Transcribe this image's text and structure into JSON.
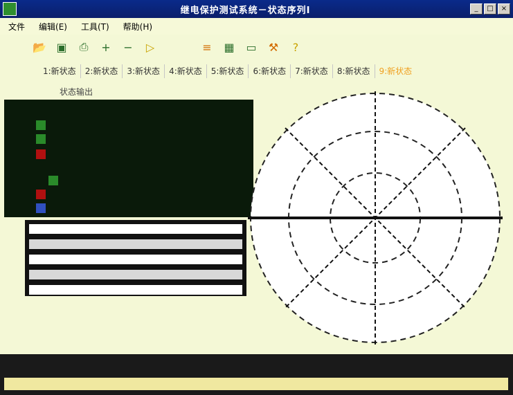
{
  "window": {
    "title": "继电保护测试系统－状态序列Ⅰ",
    "controls": [
      "_",
      "□",
      "×"
    ]
  },
  "menu": {
    "items": [
      "文件",
      "编辑(E)",
      "工具(T)",
      "帮助(H)"
    ]
  },
  "toolbar": {
    "icons": [
      "open-icon",
      "save-icon",
      "print-icon",
      "add-icon",
      "remove-icon",
      "play-icon",
      "settings-icon",
      "view-icon",
      "monitor-icon",
      "tool-icon",
      "help-icon"
    ]
  },
  "tabs": [
    {
      "label": "1:新状态"
    },
    {
      "label": "2:新状态"
    },
    {
      "label": "3:新状态"
    },
    {
      "label": "4:新状态"
    },
    {
      "label": "5:新状态"
    },
    {
      "label": "6:新状态"
    },
    {
      "label": "7:新状态"
    },
    {
      "label": "8:新状态"
    },
    {
      "label": "9:新状态"
    }
  ],
  "panel": {
    "header": "状态输出"
  },
  "colors": {
    "titlebar": "#0b1f6b",
    "accent_tab": "#f0a020",
    "led_green": "#2a8a2a",
    "led_red": "#b01010"
  }
}
